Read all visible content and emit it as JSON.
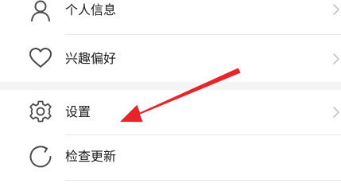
{
  "menu": {
    "items": [
      {
        "label": "个人信息",
        "icon": "person-icon"
      },
      {
        "label": "兴趣偏好",
        "icon": "heart-icon"
      },
      {
        "label": "设置",
        "icon": "gear-icon"
      },
      {
        "label": "检查更新",
        "icon": "refresh-icon"
      }
    ]
  },
  "colors": {
    "arrow": "#e8232a",
    "chevron": "#c4c4c4",
    "icon": "#4a4a4a"
  }
}
